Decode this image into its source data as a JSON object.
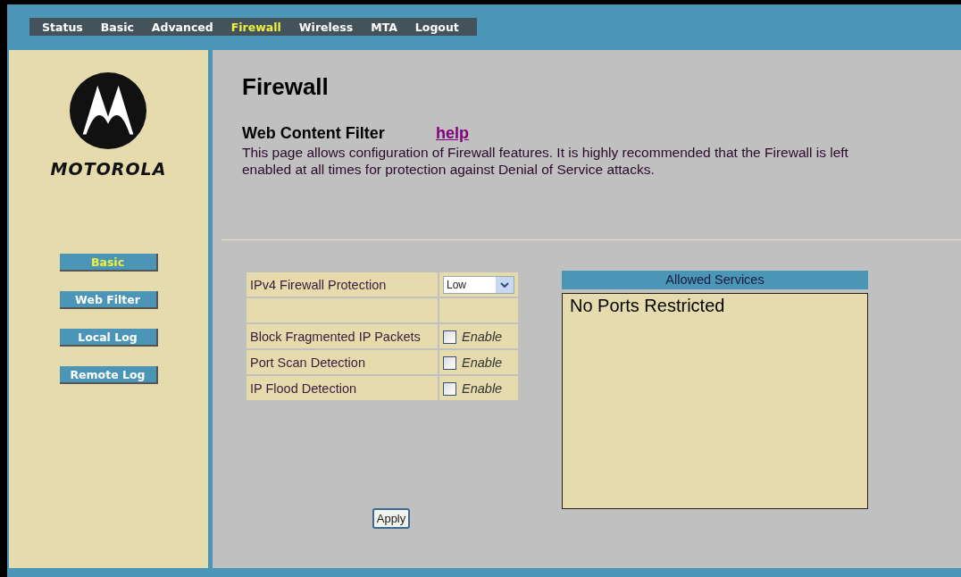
{
  "nav": [
    {
      "label": "Status",
      "selected": false
    },
    {
      "label": "Basic",
      "selected": false
    },
    {
      "label": "Advanced",
      "selected": false
    },
    {
      "label": "Firewall",
      "selected": true
    },
    {
      "label": "Wireless",
      "selected": false
    },
    {
      "label": "MTA",
      "selected": false
    },
    {
      "label": "Logout",
      "selected": false
    }
  ],
  "logo": {
    "wordmark": "MOTOROLA"
  },
  "sidebar": {
    "items": [
      {
        "label": "Basic",
        "selected": true
      },
      {
        "label": "Web Filter",
        "selected": false
      },
      {
        "label": "Local Log",
        "selected": false
      },
      {
        "label": "Remote Log",
        "selected": false
      }
    ]
  },
  "page": {
    "title": "Firewall",
    "subtitle": "Web Content Filter",
    "help_link": "help",
    "description": "This page allows configuration of Firewall features. It is highly recommended that the Firewall is left enabled at all times for protection against Denial of Service attacks."
  },
  "settings": [
    {
      "kind": "select",
      "label": "IPv4 Firewall Protection",
      "value": "Low"
    },
    {
      "kind": "blank"
    },
    {
      "kind": "checkbox",
      "label": "Block Fragmented IP Packets",
      "checked": false,
      "option": "Enable"
    },
    {
      "kind": "checkbox",
      "label": "Port Scan Detection",
      "checked": false,
      "option": "Enable"
    },
    {
      "kind": "checkbox",
      "label": "IP Flood Detection",
      "checked": false,
      "option": "Enable"
    }
  ],
  "allowed_services": {
    "title": "Allowed Services",
    "content": "No Ports Restricted"
  },
  "apply_button": "Apply"
}
